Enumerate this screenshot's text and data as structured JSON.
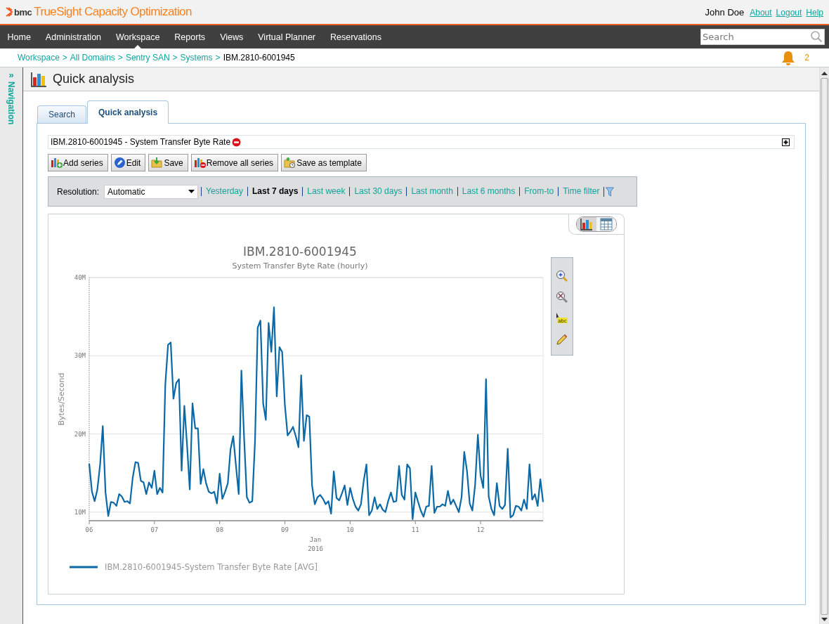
{
  "header": {
    "logo": "bmc",
    "product": "TrueSight Capacity Optimization",
    "user": "John Doe",
    "links": [
      "About",
      "Logout",
      "Help"
    ]
  },
  "nav": {
    "items": [
      {
        "label": "Home",
        "selected": false
      },
      {
        "label": "Administration",
        "selected": false
      },
      {
        "label": "Workspace",
        "selected": true
      },
      {
        "label": "Reports",
        "selected": false
      },
      {
        "label": "Views",
        "selected": false
      },
      {
        "label": "Virtual Planner",
        "selected": false
      },
      {
        "label": "Reservations",
        "selected": false
      }
    ],
    "search": {
      "placeholder": "Search"
    }
  },
  "breadcrumb": {
    "separator": ">",
    "links": [
      "Workspace",
      "All Domains",
      "Sentry SAN",
      "Systems"
    ],
    "current": "IBM.2810-6001945"
  },
  "notifications": {
    "count": "2"
  },
  "sidebar": {
    "toggle": "»",
    "label": "Navigation"
  },
  "page_title": "Quick analysis",
  "tabs": [
    {
      "label": "Search",
      "selected": false
    },
    {
      "label": "Quick analysis",
      "selected": true
    }
  ],
  "series_bar": {
    "label": "IBM.2810-6001945 - System Transfer Byte Rate"
  },
  "toolbar": [
    {
      "kind": "add",
      "label": "Add series"
    },
    {
      "kind": "edit",
      "label": "Edit"
    },
    {
      "kind": "save",
      "label": "Save"
    },
    {
      "kind": "remove",
      "label": "Remove all series"
    },
    {
      "kind": "template",
      "label": "Save as template"
    }
  ],
  "time_filter": {
    "resolution_label": "Resolution:",
    "resolution": "Automatic",
    "ranges": [
      {
        "label": "Yesterday",
        "selected": false
      },
      {
        "label": "Last 7 days",
        "selected": true
      },
      {
        "label": "Last week",
        "selected": false
      },
      {
        "label": "Last 30 days",
        "selected": false
      },
      {
        "label": "Last month",
        "selected": false
      },
      {
        "label": "Last 6 months",
        "selected": false
      },
      {
        "label": "From-to",
        "selected": false
      },
      {
        "label": "Time filter",
        "selected": false
      }
    ]
  },
  "view_switch": [
    {
      "kind": "chart",
      "selected": true
    },
    {
      "kind": "table",
      "selected": false
    }
  ],
  "chart_tools": [
    {
      "kind": "zoom-in"
    },
    {
      "kind": "zoom-reset"
    },
    {
      "kind": "annotate",
      "text": "abc"
    },
    {
      "kind": "pencil"
    }
  ],
  "chart": {
    "subtitle": "System Transfer Byte Rate (hourly)",
    "chart_data": {
      "type": "line",
      "title": "IBM.2810-6001945",
      "xlabel": "Jan 2016",
      "ylabel": "Bytes/Second",
      "categories": [
        "06",
        null,
        null,
        null,
        null,
        null,
        null,
        null,
        null,
        null,
        null,
        null,
        null,
        null,
        null,
        null,
        null,
        null,
        null,
        null,
        null,
        null,
        null,
        null,
        "07",
        null,
        null,
        null,
        null,
        null,
        null,
        null,
        null,
        null,
        null,
        null,
        null,
        null,
        null,
        null,
        null,
        null,
        null,
        null,
        null,
        null,
        null,
        null,
        "08",
        null,
        null,
        null,
        null,
        null,
        null,
        null,
        null,
        null,
        null,
        null,
        null,
        null,
        null,
        null,
        null,
        null,
        null,
        null,
        null,
        null,
        null,
        null,
        "09",
        null,
        null,
        null,
        null,
        null,
        null,
        null,
        null,
        null,
        null,
        null,
        null,
        null,
        null,
        null,
        null,
        null,
        null,
        null,
        null,
        null,
        null,
        null,
        "10",
        null,
        null,
        null,
        null,
        null,
        null,
        null,
        null,
        null,
        null,
        null,
        null,
        null,
        null,
        null,
        null,
        null,
        null,
        null,
        null,
        null,
        null,
        null,
        "11",
        null,
        null,
        null,
        null,
        null,
        null,
        null,
        null,
        null,
        null,
        null,
        null,
        null,
        null,
        null,
        null,
        null,
        null,
        null,
        null,
        null,
        null,
        null,
        "12",
        null,
        null,
        null,
        null,
        null,
        null,
        null,
        null,
        null,
        null,
        null,
        null,
        null,
        null,
        null,
        null,
        null,
        null,
        null,
        null,
        null,
        null,
        null
      ],
      "series": [
        {
          "name": "IBM.2810-6001945-System Transfer Byte Rate [AVG]",
          "color": "#0a69a6",
          "values": [
            16.2,
            12.6,
            11.4,
            12.9,
            16.1,
            21.0,
            12.5,
            9.5,
            11.3,
            11.2,
            10.8,
            12.3,
            12.0,
            11.3,
            11.4,
            11.1,
            14.4,
            16.4,
            16.3,
            14.0,
            13.8,
            12.3,
            13.8,
            13.1,
            15.3,
            12.3,
            13.1,
            12.5,
            26.3,
            31.4,
            31.7,
            24.5,
            26.5,
            27.0,
            15.3,
            23.6,
            18.5,
            12.9,
            23.9,
            20.7,
            20.7,
            13.6,
            15.5,
            13.7,
            12.6,
            12.4,
            12.6,
            11.1,
            14.9,
            11.7,
            12.6,
            13.7,
            18.0,
            19.7,
            15.9,
            12.3,
            28.1,
            19.4,
            11.9,
            11.2,
            11.4,
            19.1,
            33.6,
            34.5,
            23.9,
            21.8,
            34.2,
            30.5,
            36.2,
            24.8,
            31.1,
            30.5,
            23.7,
            19.8,
            20.3,
            20.9,
            19.7,
            18.3,
            27.5,
            19.1,
            22.4,
            22.2,
            13.4,
            11.0,
            11.9,
            12.2,
            11.7,
            11.0,
            11.4,
            9.8,
            15.2,
            11.8,
            11.5,
            12.4,
            13.4,
            10.9,
            13.1,
            11.7,
            10.7,
            10.2,
            11.0,
            14.0,
            16.1,
            9.6,
            10.2,
            11.9,
            10.4,
            11.0,
            10.3,
            10.0,
            11.4,
            12.5,
            11.3,
            11.4,
            15.9,
            12.2,
            11.6,
            16.1,
            15.6,
            9.1,
            12.5,
            11.3,
            10.2,
            9.4,
            10.7,
            10.8,
            15.9,
            9.9,
            10.7,
            10.7,
            11.0,
            10.8,
            12.7,
            11.0,
            11.6,
            10.8,
            10.0,
            11.9,
            17.7,
            15.3,
            11.1,
            10.2,
            13.5,
            19.9,
            14.7,
            13.1,
            27.0,
            12.0,
            10.4,
            9.6,
            13.7,
            10.8,
            10.4,
            10.9,
            18.1,
            9.3,
            9.6,
            10.8,
            10.7,
            10.2,
            11.6,
            10.4,
            16.1,
            11.6,
            12.3,
            10.8,
            14.2,
            11.3
          ]
        }
      ],
      "ylim": [
        8.9,
        40
      ],
      "grid": true,
      "yticks": [
        {
          "value": 10,
          "label": "10M"
        },
        {
          "value": 20,
          "label": "20M"
        },
        {
          "value": 30,
          "label": "30M"
        },
        {
          "value": 40,
          "label": "40M"
        }
      ]
    }
  }
}
